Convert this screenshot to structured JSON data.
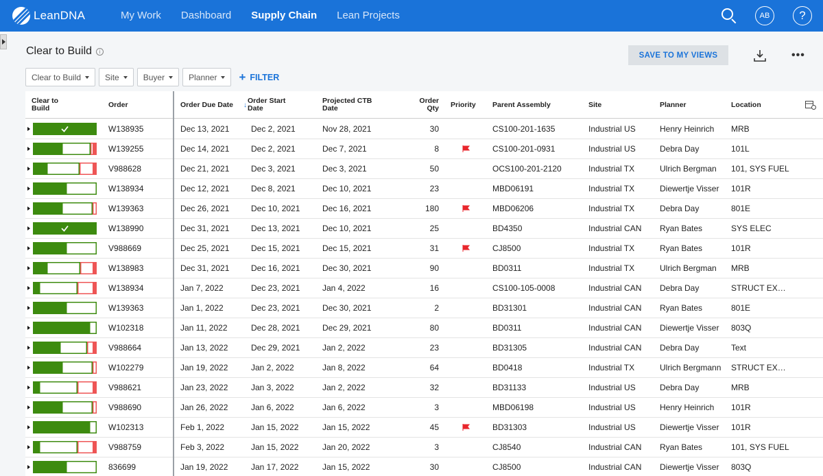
{
  "app": {
    "brand": "LeanDNA"
  },
  "nav": {
    "items": [
      {
        "label": "My Work",
        "active": false
      },
      {
        "label": "Dashboard",
        "active": false
      },
      {
        "label": "Supply Chain",
        "active": true
      },
      {
        "label": "Lean Projects",
        "active": false
      }
    ],
    "avatar": "AB",
    "help": "?"
  },
  "page": {
    "title": "Clear to Build",
    "info": "i",
    "save_label": "SAVE TO MY VIEWS",
    "more": "•••"
  },
  "filters": {
    "chips": [
      "Clear to Build",
      "Site",
      "Buyer",
      "Planner"
    ],
    "add_label": "FILTER",
    "add_plus": "+"
  },
  "colors": {
    "nav": "#1a73d9",
    "accent": "#1a73d9",
    "ready": "#3d8b0f",
    "short": "#ee5555",
    "flag": "#e8262c"
  },
  "table": {
    "headers": {
      "ctb_line1": "Clear to",
      "ctb_line2": "Build",
      "order": "Order",
      "due": "Order Due Date",
      "sort_arrow": "↓",
      "start_line1": "Order Start",
      "start_line2": "Date",
      "proj_line1": "Projected CTB",
      "proj_line2": "Date",
      "qty_line1": "Order",
      "qty_line2": "Qty",
      "priority": "Priority",
      "parent": "Parent Assembly",
      "site": "Site",
      "planner": "Planner",
      "location": "Location"
    },
    "rows": [
      {
        "ctb": {
          "ready": 1.0,
          "partial": 0,
          "short": 0,
          "check": true
        },
        "order": "W138935",
        "due": "Dec 13, 2021",
        "start": "Dec 2, 2021",
        "proj": "Nov 28, 2021",
        "qty": "30",
        "priority": false,
        "parent": "CS100-201-1635",
        "site": "Industrial US",
        "planner": "Henry Heinrich",
        "location": "MRB"
      },
      {
        "ctb": {
          "ready": 0.45,
          "partial": 0.45,
          "short": 0.1,
          "check": false
        },
        "order": "W139255",
        "due": "Dec 14, 2021",
        "start": "Dec 2, 2021",
        "proj": "Dec 7, 2021",
        "qty": "8",
        "priority": true,
        "parent": "CS100-201-0931",
        "site": "Industrial US",
        "planner": "Debra Day",
        "location": "101L"
      },
      {
        "ctb": {
          "ready": 0.22,
          "partial": 0.52,
          "short": 0.26,
          "check": false
        },
        "order": "V988628",
        "due": "Dec 21, 2021",
        "start": "Dec 3, 2021",
        "proj": "Dec 3, 2021",
        "qty": "50",
        "priority": false,
        "parent": "OCS100-201-2120",
        "site": "Industrial TX",
        "planner": "Ulrich Bergman",
        "location": "101, SYS FUEL"
      },
      {
        "ctb": {
          "ready": 0.52,
          "partial": 0.48,
          "short": 0,
          "check": false
        },
        "order": "W138934",
        "due": "Dec 12, 2021",
        "start": "Dec 8, 2021",
        "proj": "Dec 10, 2021",
        "qty": "23",
        "priority": false,
        "parent": "MBD06191",
        "site": "Industrial TX",
        "planner": "Diewertje Visser",
        "location": "101R"
      },
      {
        "ctb": {
          "ready": 0.45,
          "partial": 0.48,
          "short": 0.07,
          "check": false
        },
        "order": "W139363",
        "due": "Dec 26, 2021",
        "start": "Dec 10, 2021",
        "proj": "Dec 16, 2021",
        "qty": "180",
        "priority": true,
        "parent": "MBD06206",
        "site": "Industrial TX",
        "planner": "Debra Day",
        "location": "801E"
      },
      {
        "ctb": {
          "ready": 1.0,
          "partial": 0,
          "short": 0,
          "check": true
        },
        "order": "W138990",
        "due": "Dec 31, 2021",
        "start": "Dec 13, 2021",
        "proj": "Dec 10, 2021",
        "qty": "25",
        "priority": false,
        "parent": "BD4350",
        "site": "Industrial CAN",
        "planner": "Ryan Bates",
        "location": "SYS ELEC"
      },
      {
        "ctb": {
          "ready": 0.52,
          "partial": 0.48,
          "short": 0,
          "check": false
        },
        "order": "V988669",
        "due": "Dec 25, 2021",
        "start": "Dec 15, 2021",
        "proj": "Dec 15, 2021",
        "qty": "31",
        "priority": true,
        "parent": "CJ8500",
        "site": "Industrial TX",
        "planner": "Ryan Bates",
        "location": "101R"
      },
      {
        "ctb": {
          "ready": 0.22,
          "partial": 0.53,
          "short": 0.25,
          "check": false
        },
        "order": "W138983",
        "due": "Dec 31, 2021",
        "start": "Dec 16, 2021",
        "proj": "Dec 30, 2021",
        "qty": "90",
        "priority": false,
        "parent": "BD0311",
        "site": "Industrial TX",
        "planner": "Ulrich Bergman",
        "location": "MRB"
      },
      {
        "ctb": {
          "ready": 0.1,
          "partial": 0.6,
          "short": 0.3,
          "check": false
        },
        "order": "W138934",
        "due": "Jan 7, 2022",
        "start": "Dec 23, 2021",
        "proj": "Jan 4, 2022",
        "qty": "16",
        "priority": false,
        "parent": "CS100-105-0008",
        "site": "Industrial CAN",
        "planner": "Debra Day",
        "location": "STRUCT EX…"
      },
      {
        "ctb": {
          "ready": 0.52,
          "partial": 0.48,
          "short": 0,
          "check": false
        },
        "order": "W139363",
        "due": "Jan 1, 2022",
        "start": "Dec 23, 2021",
        "proj": "Dec 30, 2021",
        "qty": "2",
        "priority": false,
        "parent": "BD31301",
        "site": "Industrial CAN",
        "planner": "Ryan Bates",
        "location": "801E"
      },
      {
        "ctb": {
          "ready": 0.88,
          "partial": 0.12,
          "short": 0,
          "check": false
        },
        "order": "W102318",
        "due": "Jan 11, 2022",
        "start": "Dec 28, 2021",
        "proj": "Dec 29, 2021",
        "qty": "80",
        "priority": false,
        "parent": "BD0311",
        "site": "Industrial CAN",
        "planner": "Diewertje Visser",
        "location": "803Q"
      },
      {
        "ctb": {
          "ready": 0.42,
          "partial": 0.43,
          "short": 0.15,
          "check": false
        },
        "order": "V988664",
        "due": "Jan 13, 2022",
        "start": "Dec 29, 2021",
        "proj": "Jan 2, 2022",
        "qty": "23",
        "priority": false,
        "parent": "BD31305",
        "site": "Industrial CAN",
        "planner": "Debra Day",
        "location": "Text"
      },
      {
        "ctb": {
          "ready": 0.45,
          "partial": 0.48,
          "short": 0.07,
          "check": false
        },
        "order": "W102279",
        "due": "Jan 19, 2022",
        "start": "Jan 2, 2022",
        "proj": "Jan 8, 2022",
        "qty": "64",
        "priority": false,
        "parent": "BD0418",
        "site": "Industrial TX",
        "planner": "Ulrich Bergmann",
        "location": "STRUCT EX…"
      },
      {
        "ctb": {
          "ready": 0.1,
          "partial": 0.6,
          "short": 0.3,
          "check": false
        },
        "order": "V988621",
        "due": "Jan 23, 2022",
        "start": "Jan 3, 2022",
        "proj": "Jan 2, 2022",
        "qty": "32",
        "priority": false,
        "parent": "BD31133",
        "site": "Industrial US",
        "planner": "Debra Day",
        "location": "MRB"
      },
      {
        "ctb": {
          "ready": 0.45,
          "partial": 0.48,
          "short": 0.07,
          "check": false
        },
        "order": "V988690",
        "due": "Jan 26, 2022",
        "start": "Jan 6, 2022",
        "proj": "Jan 6, 2022",
        "qty": "3",
        "priority": false,
        "parent": "MBD06198",
        "site": "Industrial US",
        "planner": "Henry Heinrich",
        "location": "101R"
      },
      {
        "ctb": {
          "ready": 0.88,
          "partial": 0.12,
          "short": 0,
          "check": false
        },
        "order": "W102313",
        "due": "Feb 1, 2022",
        "start": "Jan 15, 2022",
        "proj": "Jan 15, 2022",
        "qty": "45",
        "priority": true,
        "parent": "BD31303",
        "site": "Industrial US",
        "planner": "Diewertje Visser",
        "location": "101R"
      },
      {
        "ctb": {
          "ready": 0.1,
          "partial": 0.6,
          "short": 0.3,
          "check": false
        },
        "order": "V988759",
        "due": "Feb 3, 2022",
        "start": "Jan 15, 2022",
        "proj": "Jan 20, 2022",
        "qty": "3",
        "priority": false,
        "parent": "CJ8540",
        "site": "Industrial CAN",
        "planner": "Ryan Bates",
        "location": "101, SYS FUEL"
      },
      {
        "ctb": {
          "ready": 0.52,
          "partial": 0.48,
          "short": 0,
          "check": false
        },
        "order": "836699",
        "due": "Jan 19, 2022",
        "start": "Jan 17, 2022",
        "proj": "Jan 15, 2022",
        "qty": "30",
        "priority": false,
        "parent": "CJ8500",
        "site": "Industrial CAN",
        "planner": "Diewertje Visser",
        "location": "803Q"
      }
    ]
  }
}
